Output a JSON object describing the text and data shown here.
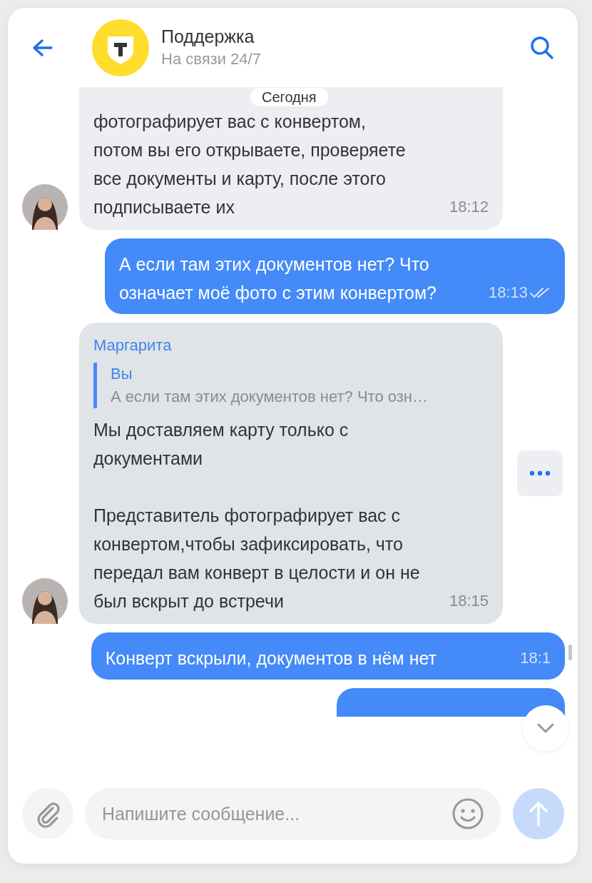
{
  "header": {
    "title": "Поддержка",
    "subtitle": "На связи 24/7"
  },
  "date_divider": "Сегодня",
  "messages": [
    {
      "kind": "incoming",
      "highlighted": false,
      "text": "фотографирует вас с конвертом,\nпотом вы его открываете, проверяете\nвсе документы и карту, после этого\nподписываете их",
      "time": "18:12"
    },
    {
      "kind": "outgoing",
      "read": true,
      "text": "А если там этих документов нет? Что\nозначает моё фото с этим конвертом?",
      "time": "18:13"
    },
    {
      "kind": "incoming",
      "highlighted": true,
      "sender": "Маргарита",
      "reply": {
        "author": "Вы",
        "text": "А если там этих документов нет? Что озн…"
      },
      "text": "Мы доставляем карту только с\nдокументами\n\nПредставитель фотографирует вас с\nконвертом,чтобы зафиксировать, что\nпередал вам конверт в целости и он не\nбыл вскрыт до встречи",
      "time": "18:15"
    },
    {
      "kind": "outgoing",
      "read": false,
      "text": "Конверт вскрыли, документов в нём нет",
      "time": "18:1"
    },
    {
      "kind": "cut"
    }
  ],
  "composer": {
    "placeholder": "Напишите сообщение..."
  }
}
